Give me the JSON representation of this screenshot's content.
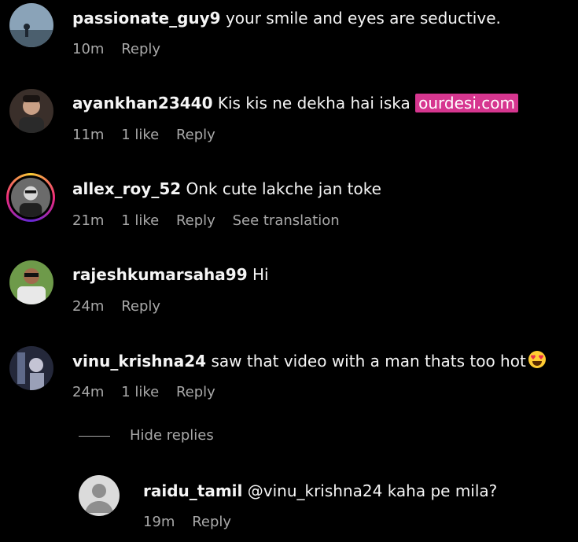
{
  "comments": [
    {
      "username": "passionate_guy9",
      "text": "your smile and eyes are seductive.",
      "time": "10m",
      "likes": "",
      "reply": "Reply",
      "translate": ""
    },
    {
      "username": "ayankhan23440",
      "text": "Kis kis ne dekha hai iska",
      "highlight": "ourdesi.com",
      "time": "11m",
      "likes": "1 like",
      "reply": "Reply",
      "translate": ""
    },
    {
      "username": "allex_roy_52",
      "text": "Onk cute lakche jan toke",
      "time": "21m",
      "likes": "1 like",
      "reply": "Reply",
      "translate": "See translation"
    },
    {
      "username": "rajeshkumarsaha99",
      "text": "Hi",
      "time": "24m",
      "likes": "",
      "reply": "Reply",
      "translate": ""
    },
    {
      "username": "vinu_krishna24",
      "text": "saw that video with a man thats too hot",
      "time": "24m",
      "likes": "1 like",
      "reply": "Reply",
      "translate": ""
    }
  ],
  "hide_replies": "Hide replies",
  "reply": {
    "username": "raidu_tamil",
    "text": "@vinu_krishna24 kaha pe mila?",
    "time": "19m",
    "reply": "Reply"
  },
  "colors": {
    "background": "#000000",
    "meta": "#a8a8a8",
    "highlight": "#d6368f",
    "story_ring": "#e1306c"
  },
  "icons": {
    "heart_eyes_emoji": "heart-eyes-emoji-icon",
    "default_avatar": "default-avatar-icon"
  }
}
